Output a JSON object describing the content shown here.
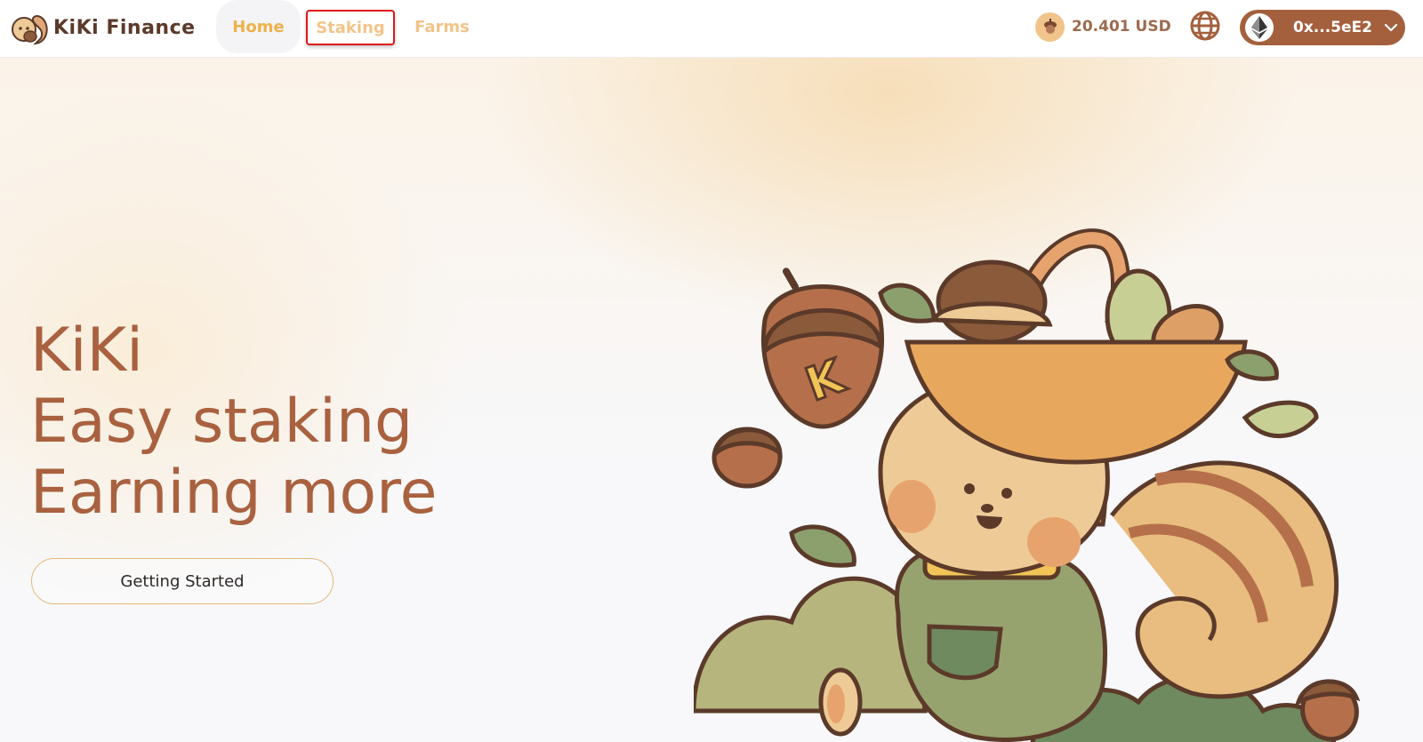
{
  "header": {
    "logo_text": "KiKi Finance",
    "nav": [
      {
        "label": "Home"
      },
      {
        "label": "Staking"
      },
      {
        "label": "Farms"
      }
    ],
    "balance": "20.401 USD",
    "wallet_address": "0x...5eE2",
    "icons": [
      "squirrel-logo-icon",
      "acorn-coin-icon",
      "globe-icon",
      "ethereum-icon",
      "chevron-down-icon"
    ]
  },
  "hero": {
    "lines": [
      "KiKi",
      "Easy staking",
      "Earning more"
    ],
    "cta_label": "Getting Started"
  },
  "colors": {
    "brand_brown": "#a9613f",
    "nav_gold": "#efb14a",
    "wallet_bg": "#a4603d",
    "highlight_box": "#e01818"
  }
}
